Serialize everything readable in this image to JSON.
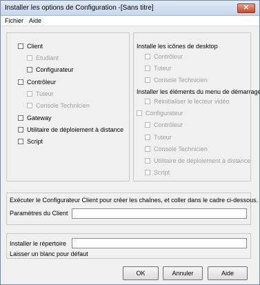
{
  "window": {
    "title": "Installer les options de Configuration -[Sans titre]",
    "close_glyph": "✕"
  },
  "menu": {
    "file": "Fichier",
    "help": "Aide"
  },
  "left_options": {
    "client": "Client",
    "etudiant": "Etudiant",
    "configurateur": "Configurateur",
    "controleur": "Contrôleur",
    "tuteur": "Tuteur",
    "console_technicien": "Console Technicien",
    "gateway": "Gateway",
    "utilitaire": "Utilitaire de déploiement à distance",
    "script": "Script"
  },
  "desktop_icons": {
    "heading": "Installe les icônes de desktop",
    "controleur": "Contrôleur",
    "tuteur": "Tuteur",
    "console_technicien": "Console Technicien"
  },
  "start_menu": {
    "heading": "Installer les éléments du menu de démarrage",
    "reinitialiser": "Réinitialiser le lecteur vidéo",
    "configurateur": "Configurateur",
    "controleur": "Contrôleur",
    "tuteur": "Tuteur",
    "console_technicien": "Console Technicien",
    "utilitaire": "Utilitaire de déploiement à distance",
    "script": "Script"
  },
  "client_params": {
    "instruction": "Exécuter le Configurateur Client pour créer les chaînes, et coller dans le cadre ci-dessous.",
    "label": "Paramètres du Client",
    "value": ""
  },
  "install_dir": {
    "label": "Installer le répertoire",
    "hint": "Laisser un blanc pour défaut",
    "value": ""
  },
  "buttons": {
    "ok": "OK",
    "cancel": "Annuler",
    "help": "Aide"
  }
}
